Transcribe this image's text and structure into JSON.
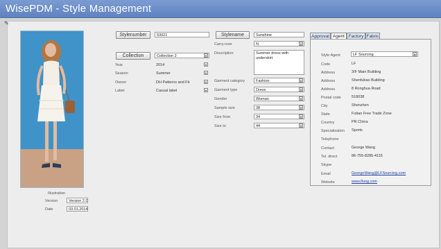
{
  "app": {
    "title": "WisePDM - Style Management"
  },
  "left": {
    "illustration_label": "Illustration",
    "version_label": "Version",
    "version_value": "Version 2.0",
    "date_label": "Date",
    "date_value": "03.01.2014"
  },
  "style": {
    "stylenumber_button": "Stylenumber",
    "stylenumber_value": "53021",
    "stylename_button": "Stylename",
    "stylename_value": "Sunshine",
    "collection_button": "Collection",
    "collection_value": "Collection 2",
    "year_label": "Year",
    "year_value": "2014",
    "season_label": "Season",
    "season_value": "Summer",
    "owner_label": "Owner",
    "owner_value": "DH Patterns and Fit",
    "label_label": "Label",
    "label_value": "Casual label",
    "carryover_label": "Carry-over",
    "carryover_value": "N",
    "description_label": "Description",
    "description_value": "Summer dress with underskirt",
    "garment_category_label": "Garment category",
    "garment_category_value": "Fashion",
    "garment_type_label": "Garment type",
    "garment_type_value": "Dress",
    "gender_label": "Gender",
    "gender_value": "Woman",
    "sample_size_label": "Sample size",
    "sample_size_value": "38",
    "size_from_label": "Size from",
    "size_from_value": "34",
    "size_to_label": "Size to",
    "size_to_value": "44"
  },
  "tabs": [
    "Approval",
    "Agent",
    "Factory",
    "Fabric"
  ],
  "agent": {
    "style_agent_label": "Style Agent",
    "style_agent_value": "LF Sourcing",
    "code_label": "Code",
    "code_value": "LF",
    "address_label": "Address",
    "address1": "3/F Main Building",
    "address2": "Shenfubao Building",
    "address3": "8 Ronghua Road",
    "postal_code_label": "Postal code",
    "postal_code_value": "518038",
    "city_label": "City",
    "city_value": "Shenzhen",
    "state_label": "State",
    "state_value": "Futian Free Trade Zone",
    "country_label": "Country",
    "country_value": "PR China",
    "specialization_label": "Specialization",
    "specialization_value": "Sports",
    "telephone_label": "Telephone",
    "contact_label": "Contact",
    "contact_value": "George Wang",
    "tel_direct_label": "Tel. direct",
    "tel_direct_value": "86-755-8285-4115",
    "skype_label": "Skype",
    "email_label": "Email",
    "email_value": "GeorgeWang@LFSourcing.com",
    "website_label": "Website",
    "website_value": "www.lfung.com"
  }
}
